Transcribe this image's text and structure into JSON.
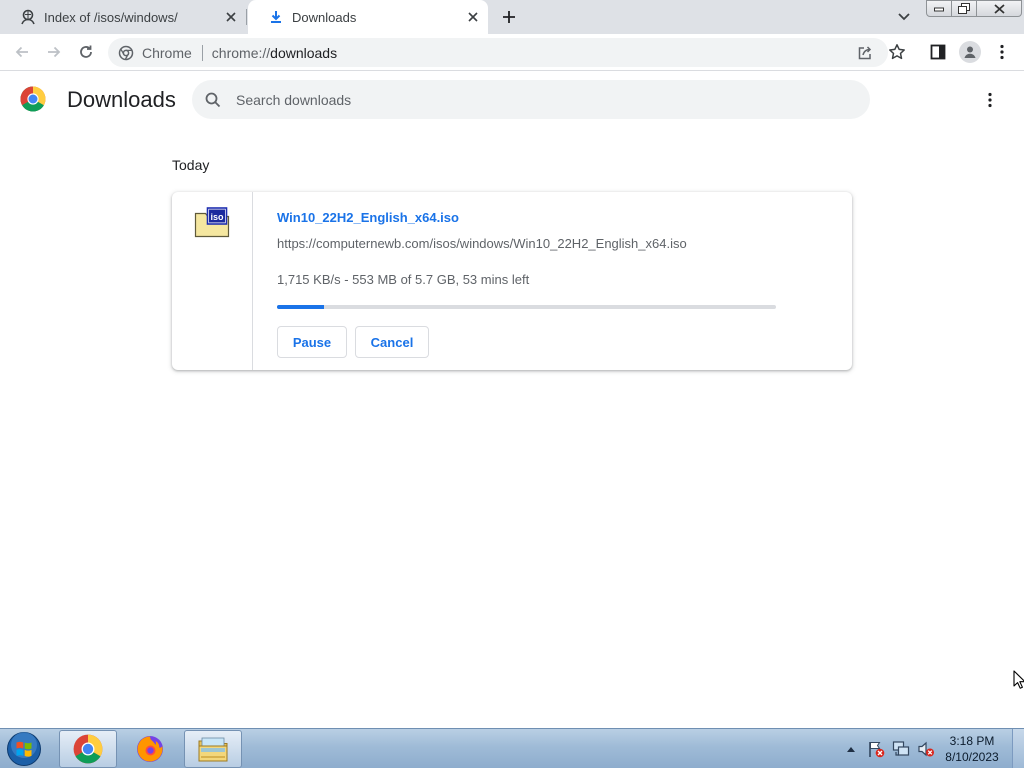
{
  "tabs": [
    {
      "title": "Index of /isos/windows/",
      "icon": "globe-user-icon",
      "active": false
    },
    {
      "title": "Downloads",
      "icon": "download-icon",
      "active": true
    }
  ],
  "toolbar": {
    "site_chip": "Chrome",
    "url_scheme": "chrome://",
    "url_path": "downloads"
  },
  "page": {
    "title": "Downloads",
    "search_placeholder": "Search downloads",
    "section_label": "Today"
  },
  "download": {
    "file_name": "Win10_22H2_English_x64.iso",
    "url": "https://computernewb.com/isos/windows/Win10_22H2_English_x64.iso",
    "status": "1,715 KB/s - 553 MB of 5.7 GB, 53 mins left",
    "progress_fraction": 0.094,
    "file_icon": "iso-file-icon",
    "pause_label": "Pause",
    "cancel_label": "Cancel"
  },
  "taskbar": {
    "pinned": [
      "chrome-icon",
      "firefox-icon",
      "file-explorer-icon"
    ],
    "clock_time": "3:18 PM",
    "clock_date": "8/10/2023"
  },
  "colors": {
    "accent": "#1a73e8",
    "tabstrip": "#dee1e6",
    "omnibox": "#f1f3f4"
  }
}
